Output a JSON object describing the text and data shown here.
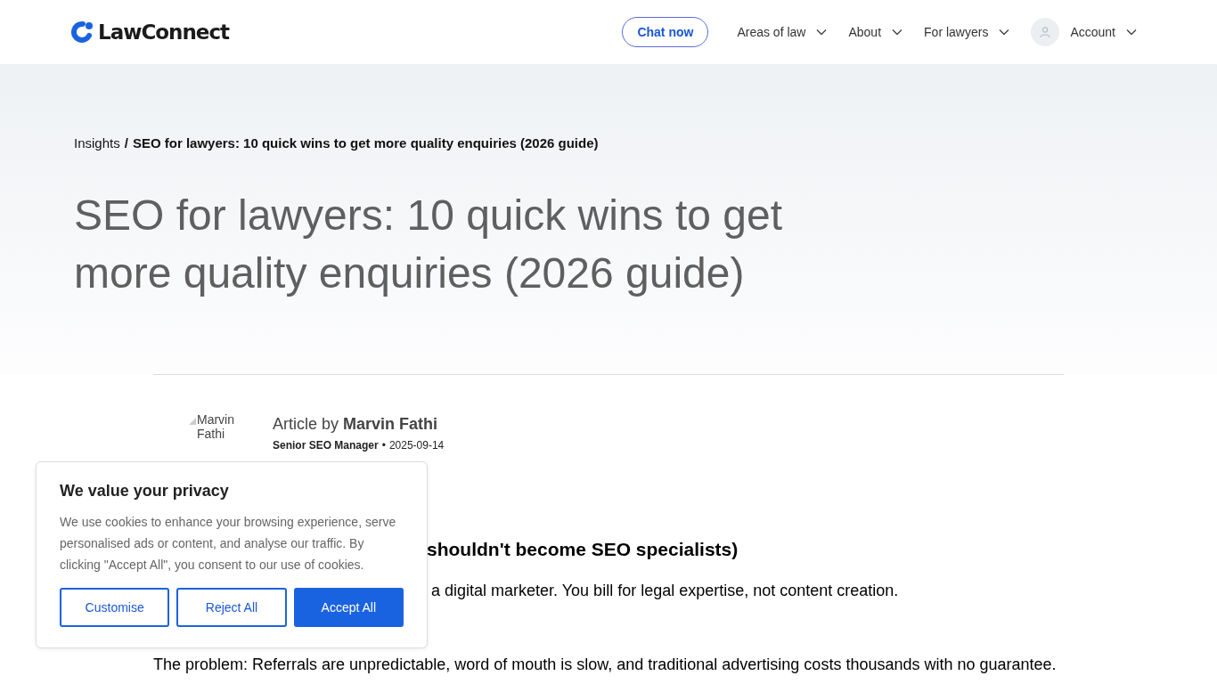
{
  "header": {
    "logo": "LawConnect",
    "chat_button": "Chat now",
    "nav": [
      {
        "label": "Areas of law",
        "kind": "dropdown"
      },
      {
        "label": "About",
        "kind": "dropdown"
      },
      {
        "label": "For lawyers",
        "kind": "dropdown"
      },
      {
        "label": "Account",
        "kind": "account"
      }
    ]
  },
  "breadcrumb": {
    "parent": "Insights",
    "separator": "/",
    "current": "SEO for lawyers: 10 quick wins to get more quality enquiries (2026 guide)"
  },
  "title": "SEO for lawyers: 10 quick wins to get more quality enquiries (2026 guide)",
  "author": {
    "image_alt": "Marvin Fathi",
    "byline": "Article by **Marvin Fathi**",
    "role": "Senior SEO Manager",
    "separator": "•",
    "date": "2025-09-14"
  },
  "article": [
    {
      "kind": "heading",
      "text": "shouldn't become SEO specialists)"
    },
    {
      "kind": "covered_paragraph",
      "text": "a digital marketer. You bill for legal expertise, not content creation."
    },
    {
      "kind": "paragraph",
      "text": "The problem: Referrals are unpredictable, word of mouth is slow, and traditional advertising costs thousands with no guarantee."
    }
  ],
  "cookie_banner": {
    "title": "We value your privacy",
    "text": "We use cookies to enhance your browsing experience, serve personalised ads or content, and analyse our traffic. By clicking \"Accept All\", you consent to our use of cookies.",
    "buttons": [
      {
        "label": "Customise",
        "kind": "outline"
      },
      {
        "label": "Reject All",
        "kind": "outline"
      },
      {
        "label": "Accept All",
        "kind": "primary"
      }
    ]
  }
}
